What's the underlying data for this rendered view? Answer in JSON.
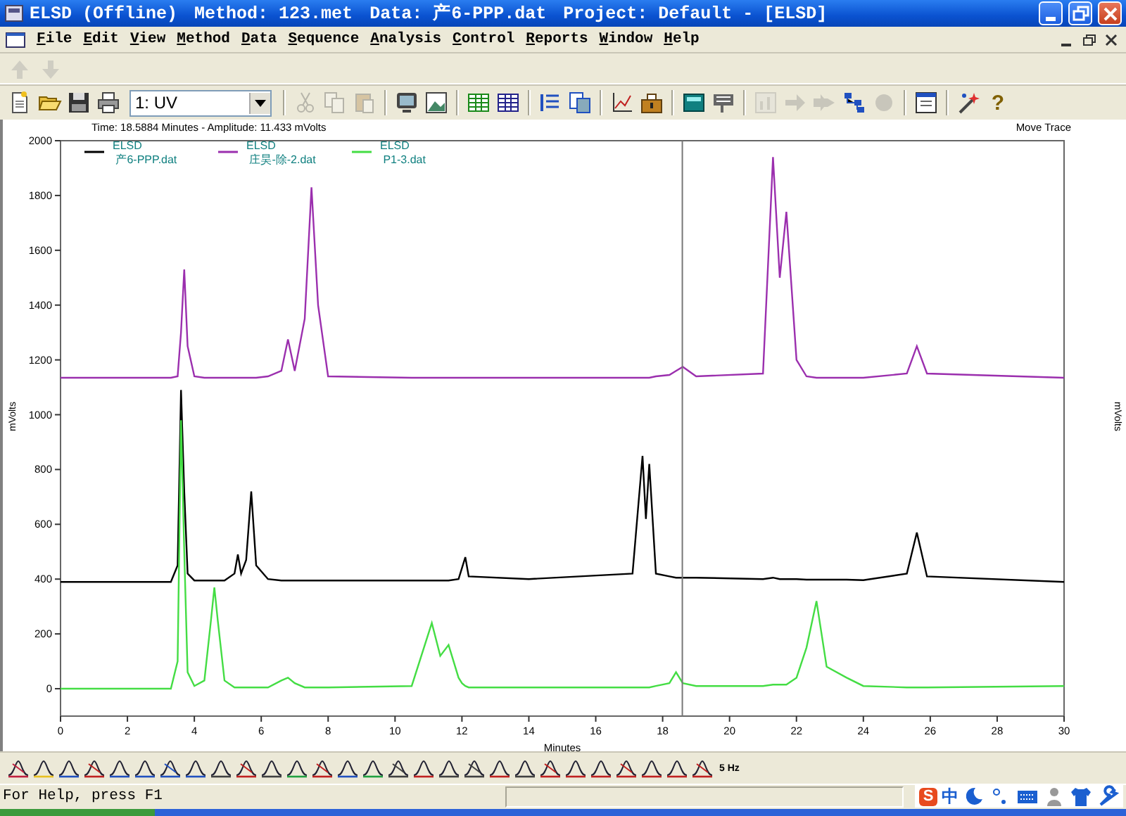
{
  "window": {
    "title_parts": [
      "ELSD (Offline)",
      "Method: 123.met",
      "Data: 产6-PPP.dat",
      "Project: Default - [ELSD]"
    ]
  },
  "menu": [
    "File",
    "Edit",
    "View",
    "Method",
    "Data",
    "Sequence",
    "Analysis",
    "Control",
    "Reports",
    "Window",
    "Help"
  ],
  "nav_toolbar": {
    "buttons": [
      {
        "disabled": true
      },
      {
        "disabled": true
      }
    ]
  },
  "main_toolbar": {
    "channel_select": {
      "value": "1: UV"
    },
    "buttons": [
      {
        "disabled": false
      },
      {
        "disabled": false
      },
      {
        "disabled": false
      },
      {
        "disabled": false
      },
      {
        "disabled": true
      },
      {
        "disabled": true
      },
      {
        "disabled": true
      },
      {
        "disabled": false
      },
      {
        "disabled": false
      },
      {
        "disabled": false
      },
      {
        "disabled": false
      },
      {
        "disabled": false
      },
      {
        "disabled": false
      },
      {
        "disabled": false
      },
      {
        "disabled": false
      },
      {
        "disabled": false
      },
      {
        "disabled": false
      },
      {
        "disabled": true
      },
      {
        "disabled": true
      },
      {
        "disabled": true
      },
      {
        "disabled": false
      },
      {
        "disabled": true
      },
      {
        "disabled": false
      },
      {
        "disabled": false
      },
      {
        "disabled": false,
        "glyph": "?"
      }
    ]
  },
  "chart_panel": {
    "readout": "Time:  18.5884 Minutes - Amplitude:  11.433 mVolts",
    "mode": "Move Trace",
    "right_axis_label": "mVolts",
    "chart_data": {
      "type": "line",
      "xlabel": "Minutes",
      "ylabel": "mVolts",
      "xlim": [
        0,
        30
      ],
      "ylim": [
        -100,
        2000
      ],
      "xticks": [
        0,
        2,
        4,
        6,
        8,
        10,
        12,
        14,
        16,
        18,
        20,
        22,
        24,
        26,
        28,
        30
      ],
      "yticks": [
        0,
        200,
        400,
        600,
        800,
        1000,
        1200,
        1400,
        1600,
        1800,
        2000
      ],
      "x": [
        0,
        2,
        3.3,
        3.5,
        3.6,
        3.7,
        3.8,
        4.0,
        4.3,
        4.5,
        4.6,
        4.7,
        4.9,
        5.2,
        5.3,
        5.4,
        5.55,
        5.7,
        5.85,
        6.2,
        6.6,
        6.8,
        7.0,
        7.3,
        7.5,
        7.7,
        8.0,
        10.5,
        11.1,
        11.35,
        11.6,
        11.9,
        12.0,
        12.1,
        12.2,
        14,
        17.1,
        17.4,
        17.5,
        17.6,
        17.8,
        18.2,
        18.4,
        18.6,
        19.0,
        21.0,
        21.3,
        21.5,
        21.7,
        22.0,
        22.3,
        22.6,
        22.9,
        23.5,
        24,
        25.3,
        25.6,
        25.9,
        30
      ],
      "series": [
        {
          "name": "ELSD 产6-PPP.dat",
          "color": "#000000",
          "values": [
            390,
            390,
            390,
            450,
            1090,
            720,
            420,
            395,
            395,
            395,
            395,
            395,
            395,
            420,
            490,
            420,
            470,
            720,
            450,
            400,
            395,
            395,
            395,
            395,
            395,
            395,
            395,
            395,
            395,
            395,
            395,
            400,
            440,
            480,
            410,
            400,
            420,
            850,
            620,
            820,
            420,
            410,
            405,
            405,
            405,
            400,
            405,
            400,
            400,
            400,
            398,
            398,
            398,
            398,
            396,
            420,
            570,
            410,
            390
          ]
        },
        {
          "name": "ELSD 庄昊-除-2.dat",
          "color": "#9b2fae",
          "values": [
            1135,
            1135,
            1135,
            1140,
            1300,
            1530,
            1250,
            1140,
            1135,
            1135,
            1135,
            1135,
            1135,
            1135,
            1135,
            1135,
            1135,
            1135,
            1135,
            1140,
            1160,
            1275,
            1160,
            1350,
            1830,
            1400,
            1140,
            1135,
            1135,
            1135,
            1135,
            1135,
            1135,
            1135,
            1135,
            1135,
            1135,
            1135,
            1135,
            1135,
            1140,
            1145,
            1160,
            1175,
            1140,
            1150,
            1940,
            1500,
            1740,
            1200,
            1140,
            1135,
            1135,
            1135,
            1135,
            1150,
            1250,
            1150,
            1135
          ]
        },
        {
          "name": "ELSD P1-3.dat",
          "color": "#44dd44",
          "values": [
            0,
            0,
            0,
            100,
            980,
            500,
            60,
            10,
            30,
            250,
            370,
            250,
            30,
            5,
            5,
            5,
            5,
            5,
            5,
            5,
            30,
            40,
            20,
            5,
            5,
            5,
            5,
            10,
            240,
            120,
            160,
            40,
            20,
            10,
            5,
            5,
            5,
            5,
            5,
            5,
            10,
            20,
            60,
            20,
            10,
            10,
            15,
            15,
            15,
            40,
            150,
            320,
            80,
            40,
            10,
            5,
            5,
            5,
            10
          ]
        }
      ],
      "legend": true,
      "ref_lines": [
        {
          "axis": "x",
          "value": 18.5884,
          "color": "#777777"
        }
      ]
    }
  },
  "peak_toolbar": {
    "rate": "5 Hz"
  },
  "status_bar": {
    "text": "For Help, press F1",
    "tray": [
      {
        "text": "S"
      },
      {
        "text": "中"
      }
    ]
  }
}
